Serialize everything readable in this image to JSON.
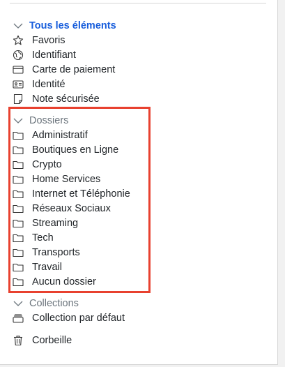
{
  "all_items": {
    "title": "Tous les éléments",
    "items": [
      {
        "label": "Favoris",
        "icon": "star-icon"
      },
      {
        "label": "Identifiant",
        "icon": "globe-icon"
      },
      {
        "label": "Carte de paiement",
        "icon": "credit-card-icon"
      },
      {
        "label": "Identité",
        "icon": "id-card-icon"
      },
      {
        "label": "Note sécurisée",
        "icon": "sticky-note-icon"
      }
    ]
  },
  "folders": {
    "title": "Dossiers",
    "items": [
      {
        "label": "Administratif"
      },
      {
        "label": "Boutiques en Ligne"
      },
      {
        "label": "Crypto"
      },
      {
        "label": "Home Services"
      },
      {
        "label": "Internet et Téléphonie"
      },
      {
        "label": "Réseaux Sociaux"
      },
      {
        "label": "Streaming"
      },
      {
        "label": "Tech"
      },
      {
        "label": "Transports"
      },
      {
        "label": "Travail"
      },
      {
        "label": "Aucun dossier"
      }
    ]
  },
  "collections": {
    "title": "Collections",
    "items": [
      {
        "label": "Collection par défaut",
        "icon": "collection-icon"
      }
    ]
  },
  "trash": {
    "label": "Corbeille",
    "icon": "trash-icon"
  },
  "colors": {
    "accent": "#175ddc",
    "highlight_border": "#e8412f",
    "muted": "#6c757d"
  }
}
